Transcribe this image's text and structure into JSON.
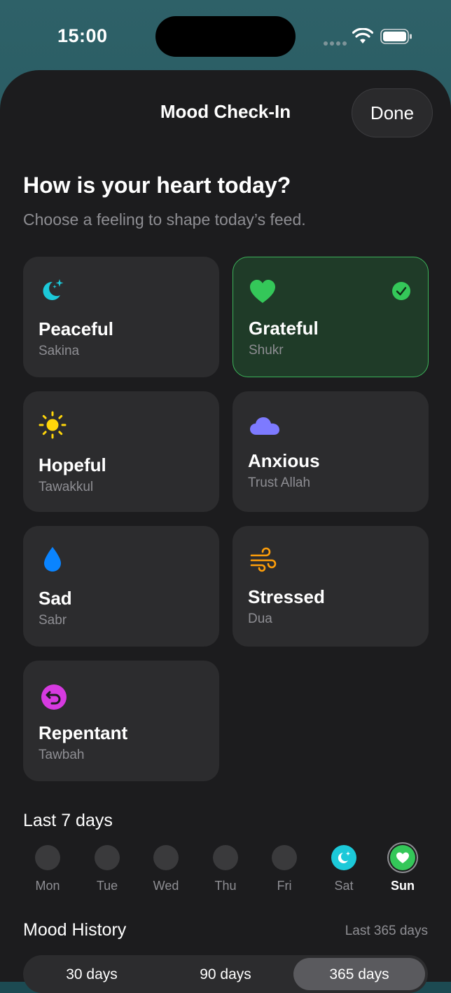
{
  "status": {
    "time": "15:00"
  },
  "header": {
    "title": "Mood Check-In",
    "done_label": "Done"
  },
  "prompt": {
    "heading": "How is your heart today?",
    "subheading": "Choose a feeling to shape today’s feed."
  },
  "moods": [
    {
      "name": "Peaceful",
      "sub": "Sakina",
      "icon": "moon-stars-icon",
      "color": "#1cc9d9",
      "selected": false
    },
    {
      "name": "Grateful",
      "sub": "Shukr",
      "icon": "heart-icon",
      "color": "#34c759",
      "selected": true
    },
    {
      "name": "Hopeful",
      "sub": "Tawakkul",
      "icon": "sun-icon",
      "color": "#ffd60a",
      "selected": false
    },
    {
      "name": "Anxious",
      "sub": "Trust Allah",
      "icon": "cloud-icon",
      "color": "#7d7aff",
      "selected": false
    },
    {
      "name": "Sad",
      "sub": "Sabr",
      "icon": "drop-icon",
      "color": "#0a84ff",
      "selected": false
    },
    {
      "name": "Stressed",
      "sub": "Dua",
      "icon": "wind-icon",
      "color": "#ff9f0a",
      "selected": false
    },
    {
      "name": "Repentant",
      "sub": "Tawbah",
      "icon": "return-arrow-icon",
      "color": "#d63ae0",
      "selected": false
    }
  ],
  "week": {
    "title": "Last 7 days",
    "days": [
      {
        "label": "Mon",
        "mood": null
      },
      {
        "label": "Tue",
        "mood": null
      },
      {
        "label": "Wed",
        "mood": null
      },
      {
        "label": "Thu",
        "mood": null
      },
      {
        "label": "Fri",
        "mood": null
      },
      {
        "label": "Sat",
        "mood": "Peaceful"
      },
      {
        "label": "Sun",
        "mood": "Grateful"
      }
    ]
  },
  "history": {
    "title": "Mood History",
    "range_label": "Last 365 days",
    "options": [
      "30 days",
      "90 days",
      "365 days"
    ],
    "selected": "365 days"
  },
  "colors": {
    "sheet": "#1c1c1e",
    "card": "#2c2c2e",
    "accent_green": "#34c759"
  }
}
